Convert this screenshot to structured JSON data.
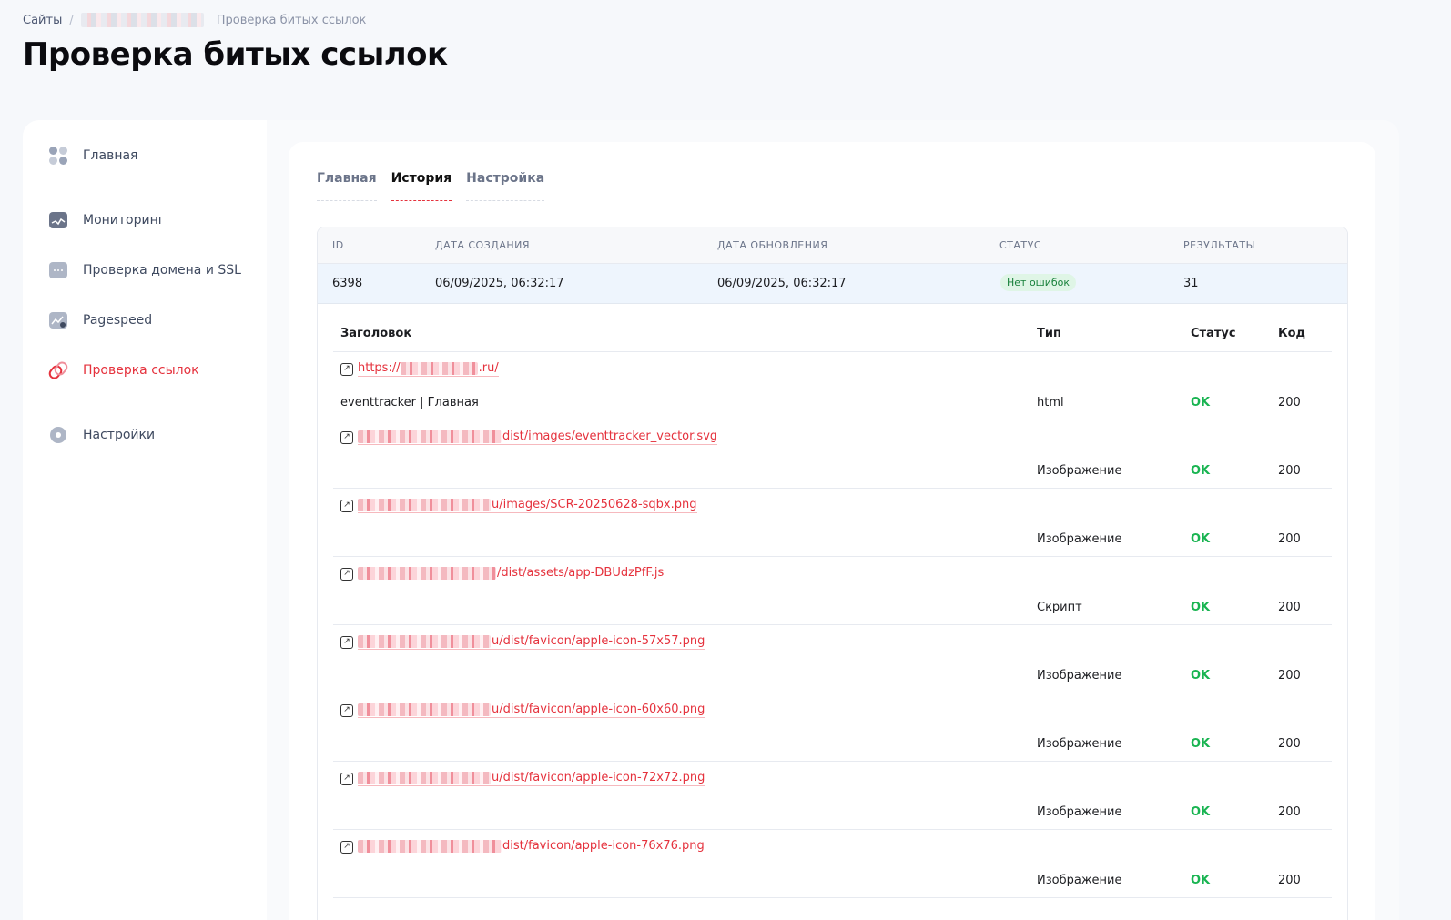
{
  "breadcrumb": {
    "root": "Сайты",
    "separator": "/",
    "current": "Проверка битых ссылок"
  },
  "page_title": "Проверка битых ссылок",
  "sidebar": {
    "items": [
      {
        "label": "Главная",
        "icon": "dashboard-icon"
      },
      {
        "label": "Мониторинг",
        "icon": "monitoring-icon"
      },
      {
        "label": "Проверка домена и SSL",
        "icon": "domain-ssl-icon"
      },
      {
        "label": "Pagespeed",
        "icon": "pagespeed-icon"
      },
      {
        "label": "Проверка ссылок",
        "icon": "links-icon",
        "active": true
      },
      {
        "label": "Настройки",
        "icon": "gear-icon"
      }
    ]
  },
  "tabs": [
    {
      "label": "Главная"
    },
    {
      "label": "История",
      "active": true
    },
    {
      "label": "Настройка"
    }
  ],
  "runs_table": {
    "headers": [
      "ID",
      "ДАТА СОЗДАНИЯ",
      "ДАТА ОБНОВЛЕНИЯ",
      "СТАТУС",
      "РЕЗУЛЬТАТЫ"
    ],
    "row": {
      "id": "6398",
      "created": "06/09/2025, 06:32:17",
      "updated": "06/09/2025, 06:32:17",
      "status": "Нет ошибок",
      "results": "31"
    }
  },
  "links_table": {
    "headers": [
      "Заголовок",
      "Тип",
      "Статус",
      "Код"
    ],
    "rows": [
      {
        "url_prefix": "https://",
        "url_suffix": ".ru/",
        "title": "eventtracker | Главная",
        "type": "html",
        "status": "OK",
        "code": "200"
      },
      {
        "url_prefix": "",
        "url_suffix": "dist/images/eventtracker_vector.svg",
        "title": "",
        "type": "Изображение",
        "status": "OK",
        "code": "200"
      },
      {
        "url_prefix": "",
        "url_suffix": "u/images/SCR-20250628-sqbx.png",
        "title": "",
        "type": "Изображение",
        "status": "OK",
        "code": "200"
      },
      {
        "url_prefix": "",
        "url_suffix": "/dist/assets/app-DBUdzPfF.js",
        "title": "",
        "type": "Скрипт",
        "status": "OK",
        "code": "200"
      },
      {
        "url_prefix": "",
        "url_suffix": "u/dist/favicon/apple-icon-57x57.png",
        "title": "",
        "type": "Изображение",
        "status": "OK",
        "code": "200"
      },
      {
        "url_prefix": "",
        "url_suffix": "u/dist/favicon/apple-icon-60x60.png",
        "title": "",
        "type": "Изображение",
        "status": "OK",
        "code": "200"
      },
      {
        "url_prefix": "",
        "url_suffix": "u/dist/favicon/apple-icon-72x72.png",
        "title": "",
        "type": "Изображение",
        "status": "OK",
        "code": "200"
      },
      {
        "url_prefix": "",
        "url_suffix": "dist/favicon/apple-icon-76x76.png",
        "title": "",
        "type": "Изображение",
        "status": "OK",
        "code": "200"
      }
    ]
  },
  "colors": {
    "accent": "#e5323d",
    "ok": "#19b451",
    "badge_bg": "#dff5e6",
    "selected_row": "#eef5fd"
  }
}
